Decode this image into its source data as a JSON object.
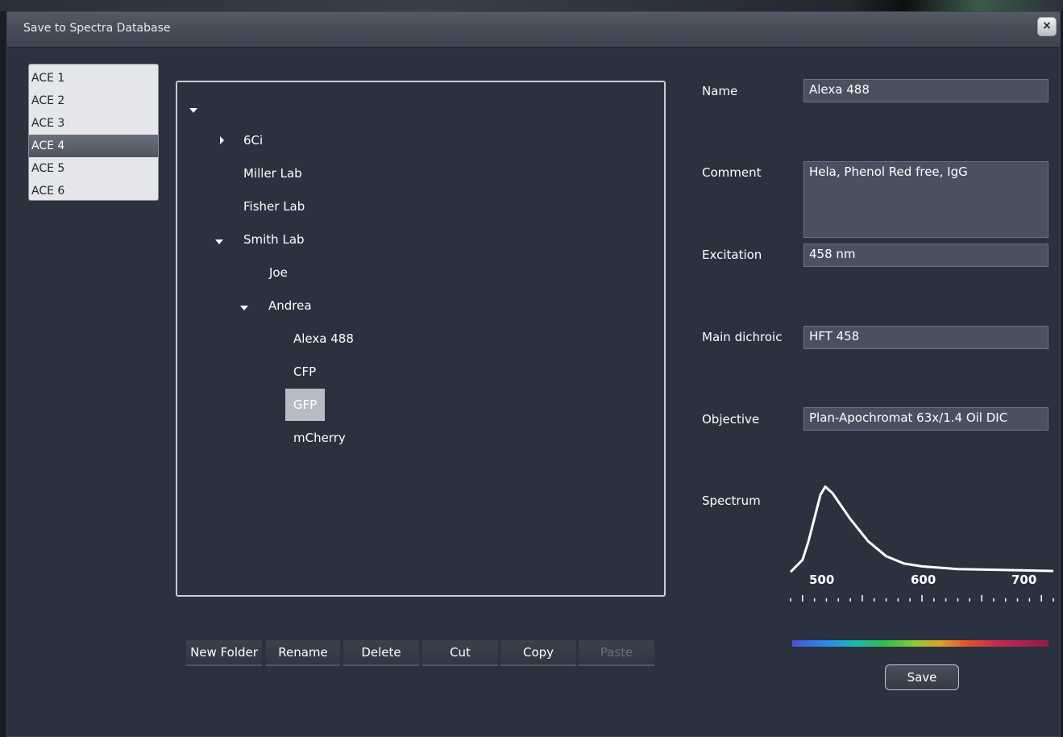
{
  "dialog": {
    "title": "Save to Spectra Database",
    "close_label": "×"
  },
  "ace_list": [
    "ACE 1",
    "ACE 2",
    "ACE 3",
    "ACE 4",
    "ACE 5",
    "ACE 6"
  ],
  "ace_selected": "ACE 4",
  "tree": {
    "root_expanded": true,
    "items": [
      {
        "label": "6Ci",
        "expander": "collapsed"
      },
      {
        "label": "Miller Lab"
      },
      {
        "label": "Fisher Lab"
      },
      {
        "label": "Smith Lab",
        "expander": "expanded"
      },
      {
        "label": "Joe"
      },
      {
        "label": "Andrea",
        "expander": "expanded"
      },
      {
        "label": "Alexa 488"
      },
      {
        "label": "CFP"
      },
      {
        "label": "GFP",
        "selected": true
      },
      {
        "label": "mCherry"
      }
    ]
  },
  "toolbar": {
    "new_folder": "New Folder",
    "rename": "Rename",
    "delete": "Delete",
    "cut": "Cut",
    "copy": "Copy",
    "paste": "Paste"
  },
  "properties": {
    "name_label": "Name",
    "name_value": "Alexa 488",
    "comment_label": "Comment",
    "comment_value": "Hela, Phenol Red free, IgG",
    "excitation_label": "Excitation",
    "excitation_value": "458 nm",
    "dichroic_label": "Main dichroic",
    "dichroic_value": "HFT 458",
    "objective_label": "Objective",
    "objective_value": "Plan-Apochromat 63x/1.4 Oil DIC",
    "spectrum_label": "Spectrum"
  },
  "spectrum": {
    "tick_labels": [
      "500",
      "600",
      "700"
    ],
    "x_range": [
      490,
      710
    ],
    "points": [
      [
        490,
        0.05
      ],
      [
        500,
        0.18
      ],
      [
        505,
        0.38
      ],
      [
        515,
        0.88
      ],
      [
        519,
        0.97
      ],
      [
        525,
        0.9
      ],
      [
        540,
        0.62
      ],
      [
        555,
        0.38
      ],
      [
        570,
        0.22
      ],
      [
        585,
        0.14
      ],
      [
        600,
        0.11
      ],
      [
        630,
        0.08
      ],
      [
        670,
        0.07
      ],
      [
        710,
        0.06
      ]
    ]
  },
  "save_label": "Save",
  "colors": {
    "dialog_bg": "#2b313f",
    "field_bg": "#495060",
    "selected_bg": "#b8bcc4"
  }
}
